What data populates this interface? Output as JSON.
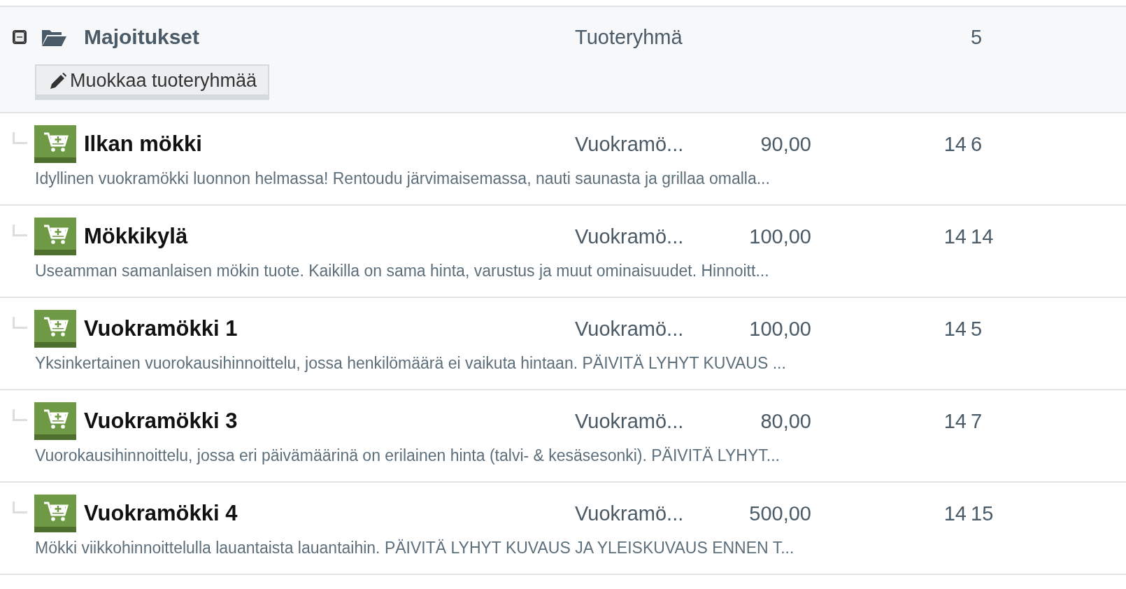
{
  "group": {
    "expanded": true,
    "name": "Majoitukset",
    "type": "Tuoteryhmä",
    "column_5": "5",
    "edit_button": "Muokkaa tuoteryhmää"
  },
  "products": [
    {
      "name": "Ilkan mökki",
      "type": "Vuokramö...",
      "price": "90,00",
      "column_4": "14",
      "column_5": "6",
      "description": "Idyllinen vuokramökki luonnon helmassa! Rentoudu järvimaisemassa, nauti saunasta ja grillaa omalla..."
    },
    {
      "name": "Mökkikylä",
      "type": "Vuokramö...",
      "price": "100,00",
      "column_4": "14",
      "column_5": "14",
      "description": "Useamman samanlaisen mökin tuote. Kaikilla on sama hinta, varustus ja muut ominaisuudet. Hinnoitt..."
    },
    {
      "name": "Vuokramökki 1",
      "type": "Vuokramö...",
      "price": "100,00",
      "column_4": "14",
      "column_5": "5",
      "description": "Yksinkertainen vuorokausihinnoittelu, jossa henkilömäärä ei vaikuta hintaan. PÄIVITÄ LYHYT KUVAUS ..."
    },
    {
      "name": "Vuokramökki 3",
      "type": "Vuokramö...",
      "price": "80,00",
      "column_4": "14",
      "column_5": "7",
      "description": "Vuorokausihinnoittelu, jossa eri päivämäärinä on erilainen hinta (talvi- & kesäsesonki). PÄIVITÄ LYHYT..."
    },
    {
      "name": "Vuokramökki 4",
      "type": "Vuokramö...",
      "price": "500,00",
      "column_4": "14",
      "column_5": "15",
      "description": "Mökki viikkohinnoittelulla lauantaista lauantaihin. PÄIVITÄ LYHYT KUVAUS JA YLEISKUVAUS ENNEN T..."
    }
  ]
}
